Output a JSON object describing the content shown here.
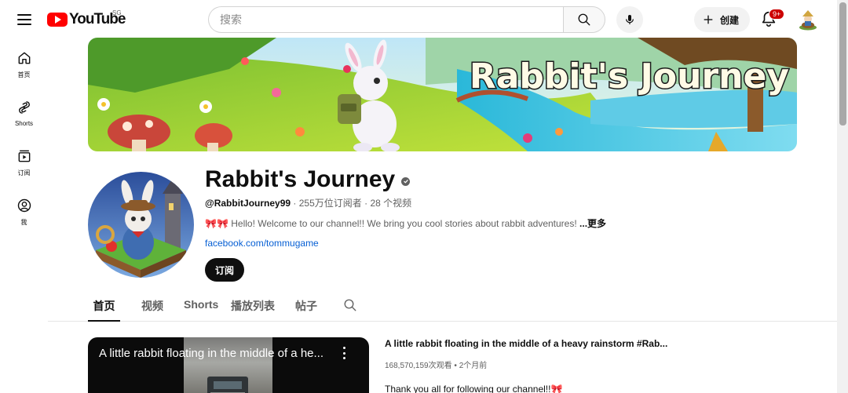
{
  "header": {
    "logo_text": "YouTube",
    "region": "SG",
    "search_placeholder": "搜索",
    "create_label": "创建",
    "notifications_badge": "9+"
  },
  "rail": {
    "items": [
      {
        "label": "首页",
        "icon": "home-icon"
      },
      {
        "label": "Shorts",
        "icon": "shorts-icon"
      },
      {
        "label": "订阅",
        "icon": "subscriptions-icon"
      },
      {
        "label": "我",
        "icon": "you-icon"
      }
    ]
  },
  "banner": {
    "title": "Rabbit's Journey"
  },
  "channel": {
    "name": "Rabbit's Journey",
    "handle": "@RabbitJourney99",
    "subscribers": "255万位订阅者",
    "videos": "28 个视频",
    "meta_separator": " · ",
    "description_emoji": "🎀🎀",
    "description": " Hello! Welcome to our channel!! We bring you cool stories about rabbit adventures! ",
    "more_label": "...更多",
    "link": "facebook.com/tommugame",
    "subscribe_label": "订阅"
  },
  "tabs": [
    {
      "label": "首页",
      "active": true
    },
    {
      "label": "视频",
      "active": false
    },
    {
      "label": "Shorts",
      "active": false
    },
    {
      "label": "播放列表",
      "active": false
    },
    {
      "label": "帖子",
      "active": false
    }
  ],
  "featured_video": {
    "overlay_title": "A little rabbit floating in the middle of a he...",
    "title": "A little rabbit floating in the middle of a heavy rainstorm #Rab...",
    "views": "168,570,159次观看",
    "separator": " • ",
    "age": "2个月前",
    "description": "Thank you all for following our channel!!🎀"
  },
  "colors": {
    "brand_red": "#ff0000",
    "badge_red": "#cc0000",
    "link_blue": "#065fd4",
    "text_primary": "#0f0f0f",
    "text_secondary": "#606060"
  }
}
